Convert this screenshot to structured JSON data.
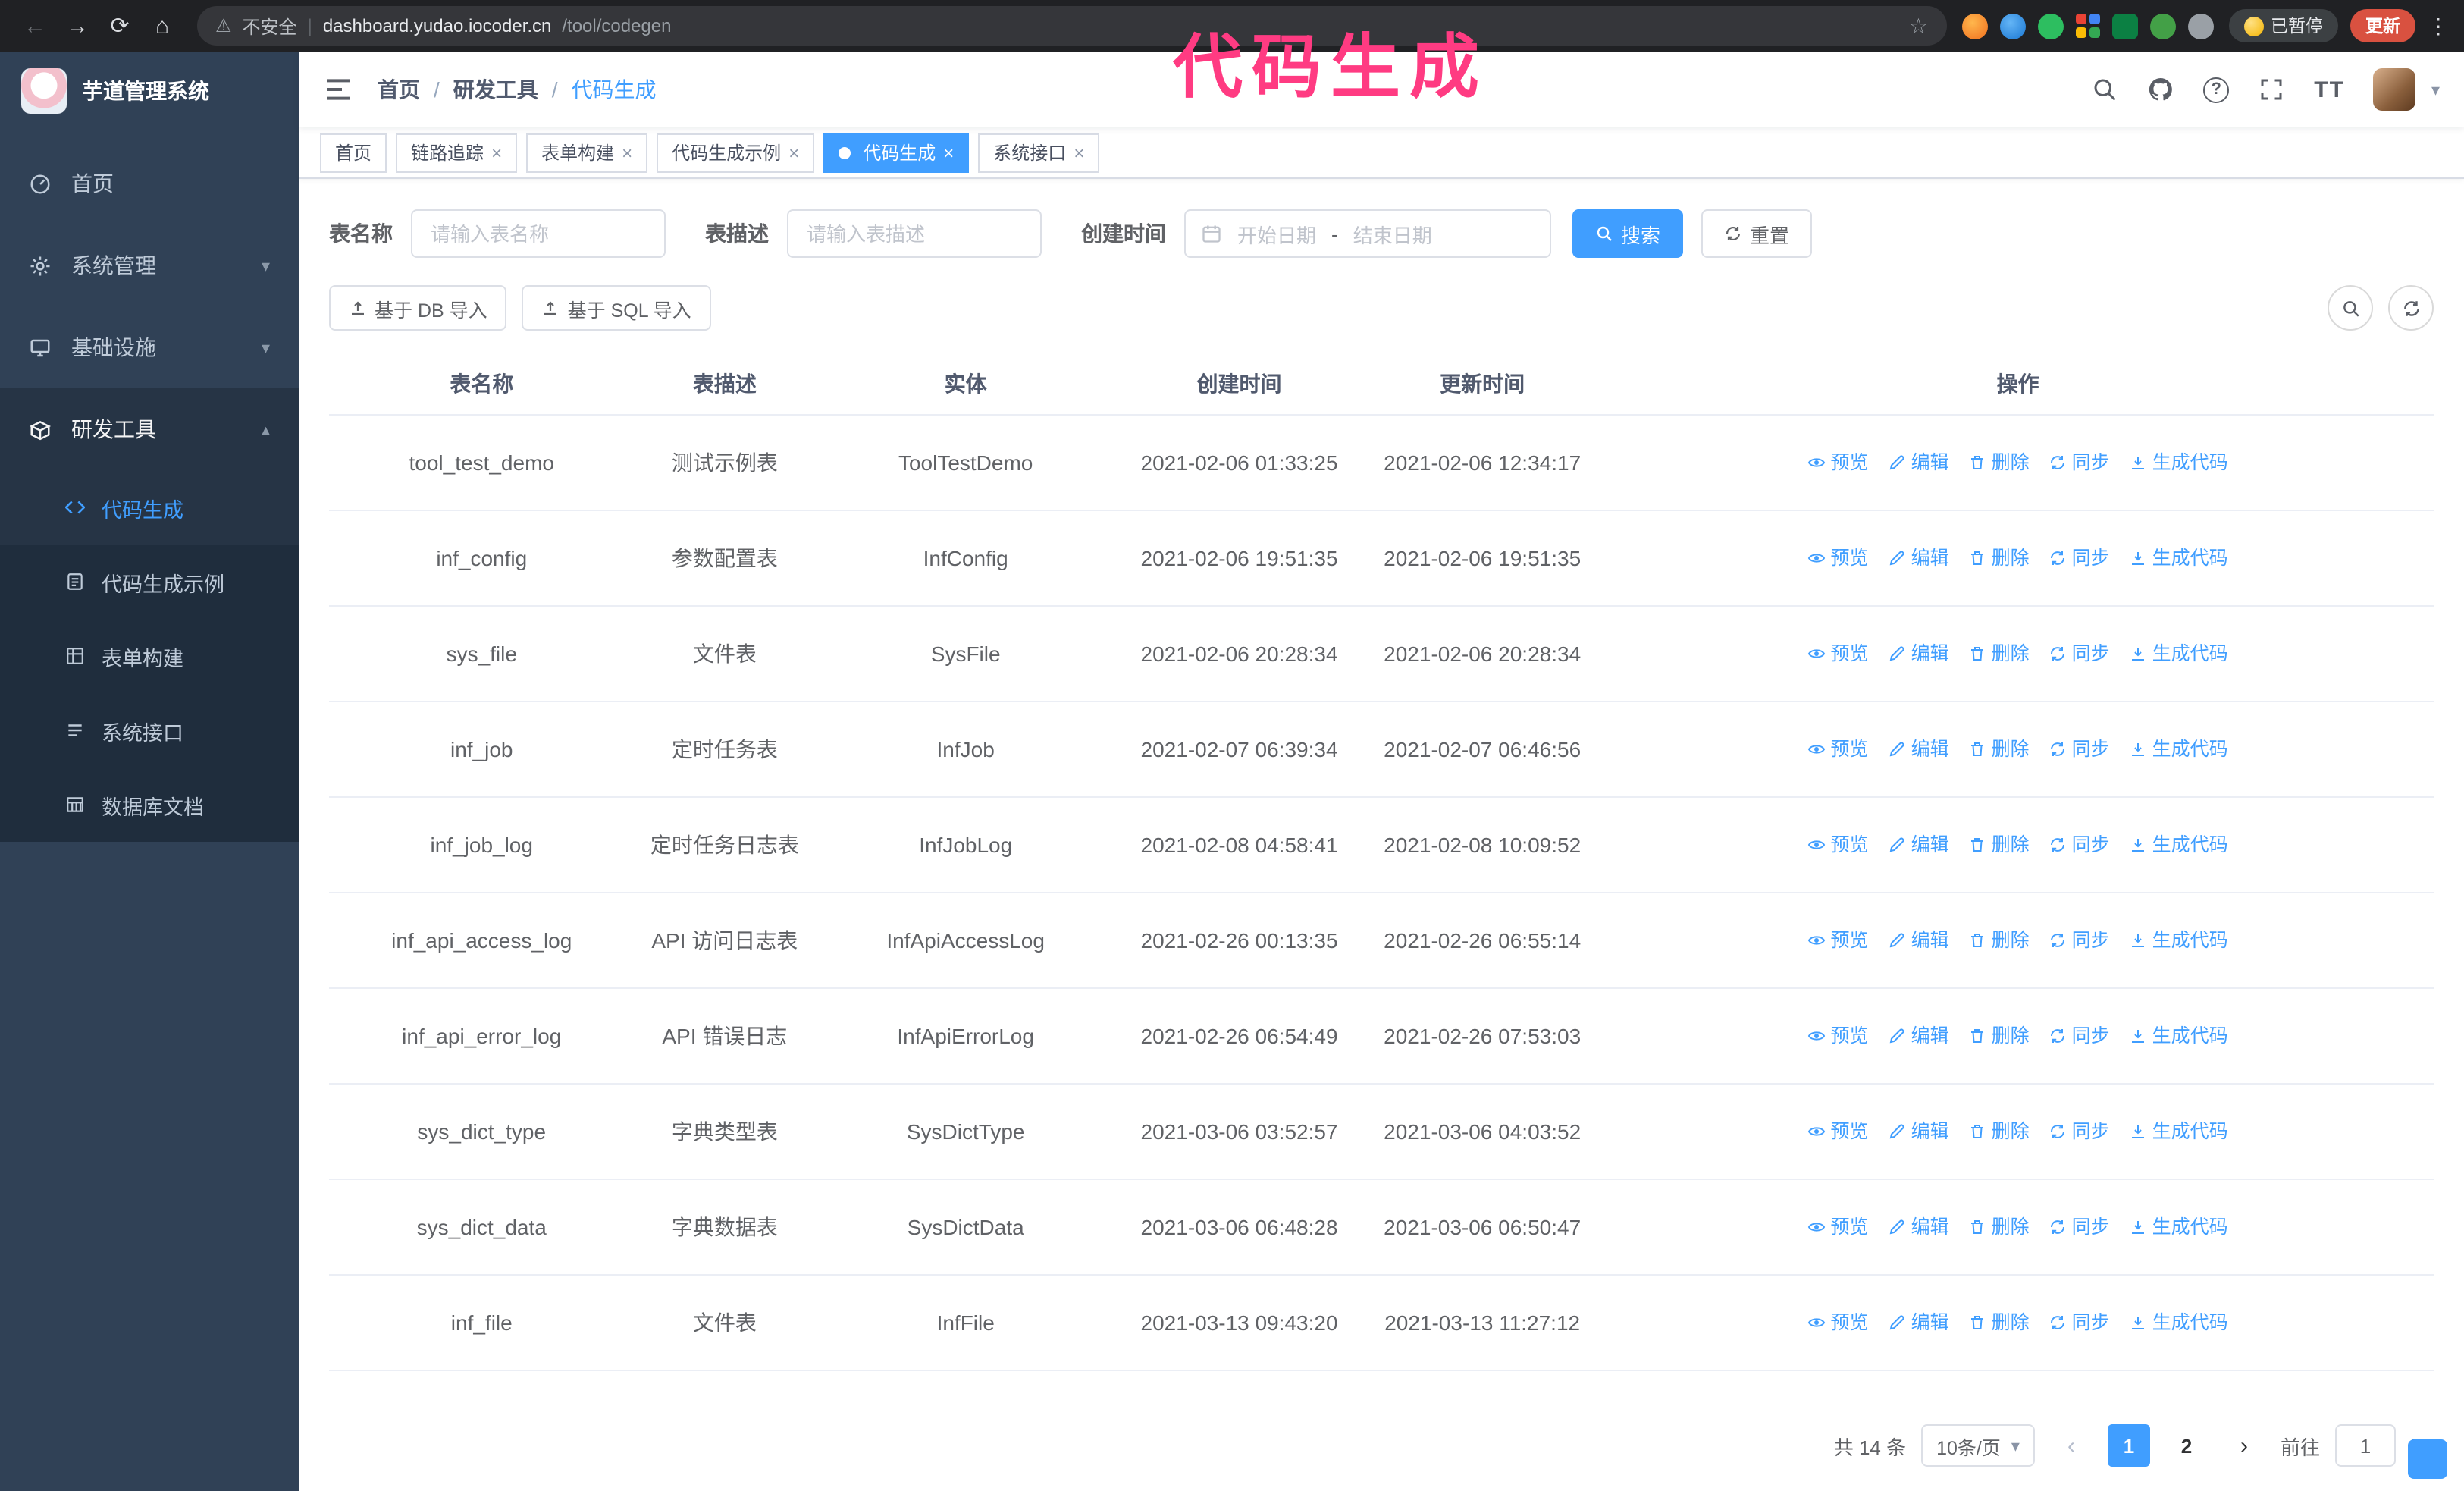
{
  "colors": {
    "accent": "#409eff",
    "sidebar_bg": "#304156",
    "submenu_bg": "#1f2d3d",
    "annotation_pink": "#ff3b82",
    "update_button_bg": "#d95140",
    "browser_bar_bg": "#202124"
  },
  "icons": {
    "back": "←",
    "forward": "→",
    "reload": "⟳",
    "home": "⌂",
    "warning": "⚠",
    "star": "☆",
    "kebab": "⋮",
    "question": "?",
    "text_size": "TT",
    "caret_down": "▾",
    "caret_up": "▴",
    "close": "×",
    "prev": "‹",
    "next": "›"
  },
  "browser": {
    "security_label": "不安全",
    "url_divider": "|",
    "url_host": "dashboard.yudao.iocoder.cn",
    "url_path": "/tool/codegen",
    "paused_badge": "已暂停",
    "update_button": "更新"
  },
  "annotation": "代码生成",
  "sidebar": {
    "logo_title": "芋道管理系统",
    "menu": [
      {
        "label": "首页"
      },
      {
        "label": "系统管理"
      },
      {
        "label": "基础设施"
      },
      {
        "label": "研发工具"
      }
    ],
    "submenu": [
      {
        "label": "代码生成"
      },
      {
        "label": "代码生成示例"
      },
      {
        "label": "表单构建"
      },
      {
        "label": "系统接口"
      },
      {
        "label": "数据库文档"
      }
    ]
  },
  "breadcrumb": {
    "separator": "/",
    "items": [
      "首页",
      "研发工具",
      "代码生成"
    ]
  },
  "tabs": [
    {
      "label": "首页",
      "closable": false,
      "active": false
    },
    {
      "label": "链路追踪",
      "closable": true,
      "active": false
    },
    {
      "label": "表单构建",
      "closable": true,
      "active": false
    },
    {
      "label": "代码生成示例",
      "closable": true,
      "active": false
    },
    {
      "label": "代码生成",
      "closable": true,
      "active": true
    },
    {
      "label": "系统接口",
      "closable": true,
      "active": false
    }
  ],
  "filters": {
    "table_name_label": "表名称",
    "table_name_placeholder": "请输入表名称",
    "table_desc_label": "表描述",
    "table_desc_placeholder": "请输入表描述",
    "create_time_label": "创建时间",
    "date_start_placeholder": "开始日期",
    "date_separator": "-",
    "date_end_placeholder": "结束日期",
    "search_button": "搜索",
    "reset_button": "重置"
  },
  "toolbar": {
    "import_db_button": "基于 DB 导入",
    "import_sql_button": "基于 SQL 导入"
  },
  "table": {
    "columns": [
      "表名称",
      "表描述",
      "实体",
      "创建时间",
      "更新时间",
      "操作"
    ],
    "actions": [
      "预览",
      "编辑",
      "删除",
      "同步",
      "生成代码"
    ],
    "rows": [
      {
        "name": "tool_test_demo",
        "desc": "测试示例表",
        "entity": "ToolTestDemo",
        "created": "2021-02-06 01:33:25",
        "updated": "2021-02-06 12:34:17"
      },
      {
        "name": "inf_config",
        "desc": "参数配置表",
        "entity": "InfConfig",
        "created": "2021-02-06 19:51:35",
        "updated": "2021-02-06 19:51:35"
      },
      {
        "name": "sys_file",
        "desc": "文件表",
        "entity": "SysFile",
        "created": "2021-02-06 20:28:34",
        "updated": "2021-02-06 20:28:34"
      },
      {
        "name": "inf_job",
        "desc": "定时任务表",
        "entity": "InfJob",
        "created": "2021-02-07 06:39:34",
        "updated": "2021-02-07 06:46:56"
      },
      {
        "name": "inf_job_log",
        "desc": "定时任务日志表",
        "entity": "InfJobLog",
        "created": "2021-02-08 04:58:41",
        "updated": "2021-02-08 10:09:52"
      },
      {
        "name": "inf_api_access_log",
        "desc": "API 访问日志表",
        "entity": "InfApiAccessLog",
        "created": "2021-02-26 00:13:35",
        "updated": "2021-02-26 06:55:14"
      },
      {
        "name": "inf_api_error_log",
        "desc": "API 错误日志",
        "entity": "InfApiErrorLog",
        "created": "2021-02-26 06:54:49",
        "updated": "2021-02-26 07:53:03"
      },
      {
        "name": "sys_dict_type",
        "desc": "字典类型表",
        "entity": "SysDictType",
        "created": "2021-03-06 03:52:57",
        "updated": "2021-03-06 04:03:52"
      },
      {
        "name": "sys_dict_data",
        "desc": "字典数据表",
        "entity": "SysDictData",
        "created": "2021-03-06 06:48:28",
        "updated": "2021-03-06 06:50:47"
      },
      {
        "name": "inf_file",
        "desc": "文件表",
        "entity": "InfFile",
        "created": "2021-03-13 09:43:20",
        "updated": "2021-03-13 11:27:12"
      }
    ]
  },
  "pagination": {
    "total_text": "共 14 条",
    "page_size": "10条/页",
    "pages": [
      "1",
      "2"
    ],
    "active_page": "1",
    "goto_label": "前往",
    "goto_value": "1",
    "goto_suffix": "页"
  }
}
